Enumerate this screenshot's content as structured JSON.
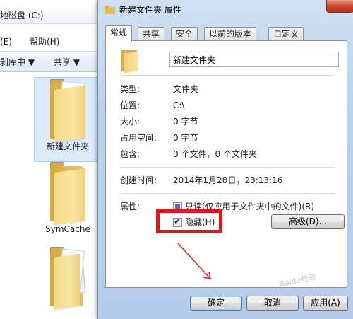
{
  "explorer": {
    "path_text": "地磁盘 (C:)",
    "menu": [
      "(E)",
      "帮助(H)"
    ],
    "toolbar": [
      "剥库中 ▼",
      "共享 ▼"
    ],
    "items": [
      {
        "label": "新建文件夹"
      },
      {
        "label": "SymCache"
      },
      {
        "label": ""
      }
    ]
  },
  "dialog": {
    "title": "新建文件夹 属性",
    "tabs": [
      "常规",
      "共享",
      "安全",
      "以前的版本",
      "自定义"
    ],
    "active_tab": "常规",
    "name_value": "新建文件夹",
    "rows": [
      {
        "label": "类型:",
        "value": "文件夹"
      },
      {
        "label": "位置:",
        "value": "C:\\"
      },
      {
        "label": "大小:",
        "value": "0 字节"
      },
      {
        "label": "占用空间:",
        "value": "0 字节"
      },
      {
        "label": "包含:",
        "value": "0 个文件，0 个文件夹"
      }
    ],
    "created": {
      "label": "创建时间:",
      "value": "2014年1月28日，23:13:16"
    },
    "attributes": {
      "label": "属性:",
      "readonly_label": "只读(仅应用于文件夹中的文件)(R)",
      "hidden_label": "隐藏(H)",
      "readonly_state": "partial",
      "hidden_checked": true,
      "advanced_button": "高级(D)..."
    },
    "buttons": {
      "ok": "确定",
      "cancel": "取消",
      "apply": "应用(A)"
    }
  },
  "colors": {
    "highlight": "#e0151b",
    "title_bar": "#bcd3ec"
  },
  "watermark": "Baidu经验"
}
